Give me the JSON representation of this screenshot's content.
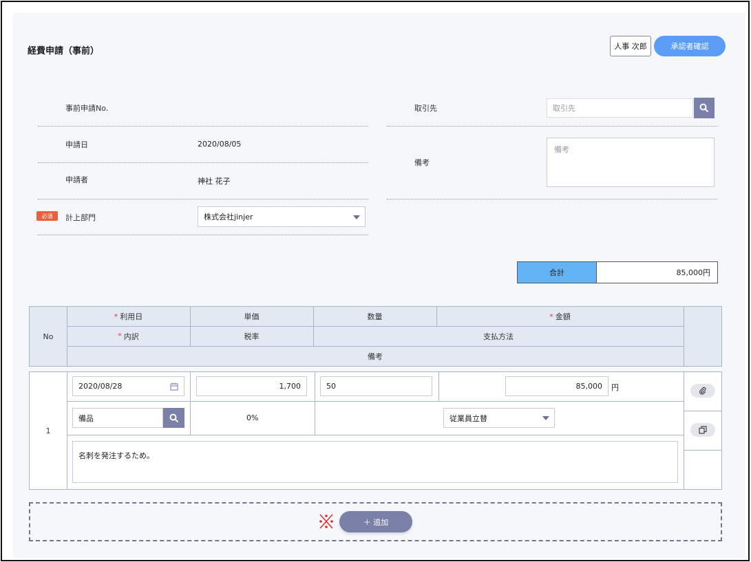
{
  "header": {
    "title": "経費申請（事前）",
    "user_button": "人事 次郎",
    "approver_button": "承認者確認"
  },
  "form": {
    "pre_no_label": "事前申請No.",
    "date_label": "申請日",
    "date_value": "2020/08/05",
    "applicant_label": "申請者",
    "applicant_value": "神社 花子",
    "required_badge": "必須",
    "department_label": "計上部門",
    "department_value": "株式会社jinjer",
    "partner_label": "取引先",
    "partner_placeholder": "取引先",
    "note_label": "備考",
    "note_placeholder": "備考"
  },
  "total": {
    "label": "合計",
    "value": "85,000円"
  },
  "table": {
    "headers": {
      "no": "No",
      "date": "利用日",
      "unit_price": "単価",
      "quantity": "数量",
      "amount": "金額",
      "detail": "内訳",
      "tax_rate": "税率",
      "payment": "支払方法",
      "note": "備考"
    },
    "rows": [
      {
        "no": "1",
        "date": "2020/08/28",
        "unit_price": "1,700",
        "quantity": "50",
        "amount": "85,000",
        "currency": "円",
        "detail": "備品",
        "tax_rate": "0%",
        "payment": "従業員立替",
        "note": "名刺を発注するため。"
      }
    ]
  },
  "add_button": "＋ 追加",
  "colors": {
    "primary": "#5b9cf4",
    "total_bg": "#63b3f5",
    "accent_button": "#7a80a8",
    "required": "#e8603c"
  }
}
